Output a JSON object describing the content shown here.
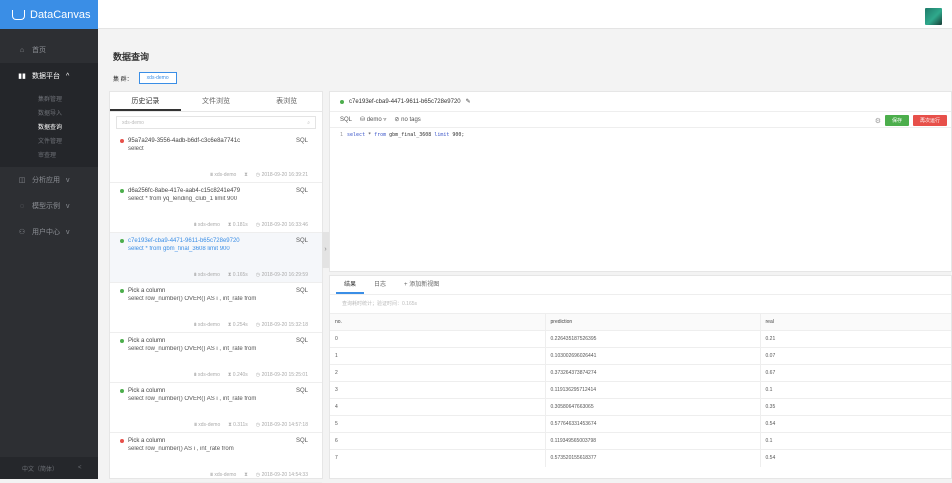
{
  "app": {
    "name": "DataCanvas"
  },
  "sidebar": {
    "items": [
      {
        "label": "首页",
        "icon": "home-icon"
      },
      {
        "label": "数据平台",
        "icon": "data-platform-icon",
        "chevron": "^"
      },
      {
        "label": "分析应用",
        "icon": "analysis-icon",
        "chevron": "v"
      },
      {
        "label": "模型示例",
        "icon": "model-icon",
        "chevron": "v"
      },
      {
        "label": "用户中心",
        "icon": "user-icon",
        "chevron": "v"
      }
    ],
    "sub_items": [
      "集群管理",
      "数据导入",
      "数据查询",
      "文件管理",
      "审查理"
    ],
    "footer": {
      "left": "中文（简体）",
      "right": "<"
    }
  },
  "page": {
    "title": "数据查询",
    "cluster_label": "集 群：",
    "cluster_value": "xds-demo"
  },
  "history": {
    "tabs": [
      "历史记录",
      "文件浏览",
      "表浏览"
    ],
    "search_placeholder": "xds-demo",
    "items": [
      {
        "id": "95a7a249-3556-4adb-b6df-c3c6e8a7741c",
        "sql": "select",
        "type": "SQL",
        "cluster": "xds-demo",
        "duration": "",
        "time": "2018-09-20 16:39:21",
        "status_color": "#e7504a",
        "selected": false
      },
      {
        "id": "d6a256fc-8abe-417e-aab4-c15c8241e479",
        "sql": "select * from yq_lending_club_1 limit 900",
        "type": "SQL",
        "cluster": "xds-demo",
        "duration": "0.181s",
        "time": "2018-09-20 16:33:46",
        "status_color": "#4cae4c",
        "selected": false
      },
      {
        "id": "c7e193ef-cba9-4471-9611-b65c728e9720",
        "sql": "select * from gbm_final_3608 limit 900",
        "type": "SQL",
        "cluster": "xds-demo",
        "duration": "0.165s",
        "time": "2018-09-20 16:29:59",
        "status_color": "#4cae4c",
        "selected": true
      },
      {
        "id": "Pick a column",
        "sql": "select row_number() OVER() AS i , int_rate from",
        "type": "SQL",
        "cluster": "xds-demo",
        "duration": "0.254s",
        "time": "2018-09-20 15:32:18",
        "status_color": "#4cae4c",
        "selected": false
      },
      {
        "id": "Pick a column",
        "sql": "select row_number() OVER() AS i , int_rate from",
        "type": "SQL",
        "cluster": "xds-demo",
        "duration": "0.240s",
        "time": "2018-09-20 15:25:01",
        "status_color": "#4cae4c",
        "selected": false
      },
      {
        "id": "Pick a column",
        "sql": "select row_number() OVER() AS i , int_rate from",
        "type": "SQL",
        "cluster": "xds-demo",
        "duration": "0.311s",
        "time": "2018-09-20 14:57:18",
        "status_color": "#4cae4c",
        "selected": false
      },
      {
        "id": "Pick a column",
        "sql": "select row_number() AS i , int_rate from",
        "type": "SQL",
        "cluster": "xds-demo",
        "duration": "",
        "time": "2018-09-20 14:54:33",
        "status_color": "#e7504a",
        "selected": false
      }
    ]
  },
  "editor": {
    "title": "c7e193ef-cba9-4471-9611-b65c728e9720",
    "mode": "SQL",
    "db": "demo",
    "tags": "no tags",
    "save_label": "保存",
    "run_label": "再次运行",
    "code": {
      "line": "1",
      "kw1": "select",
      "part1": " * ",
      "kw2": "from",
      "part2": " gbm_final_3608 ",
      "kw3": "limit",
      "part3": " 900;"
    }
  },
  "results": {
    "tabs": [
      "结果",
      "日志",
      "+ 添加新视图"
    ],
    "info": "查询耗时统计；验证时间：0.165s",
    "columns": [
      "no.",
      "prediction",
      "real"
    ],
    "rows": [
      [
        "0",
        "0.226435187526395",
        "0.21"
      ],
      [
        "1",
        "0.103002696026441",
        "0.07"
      ],
      [
        "2",
        "0.373264373874274",
        "0.67"
      ],
      [
        "3",
        "0.119136295712414",
        "0.1"
      ],
      [
        "4",
        "0.30580647663065",
        "0.35"
      ],
      [
        "5",
        "0.577646331453674",
        "0.54"
      ],
      [
        "6",
        "0.119349565003798",
        "0.1"
      ],
      [
        "7",
        "0.573520155618377",
        "0.54"
      ]
    ]
  }
}
